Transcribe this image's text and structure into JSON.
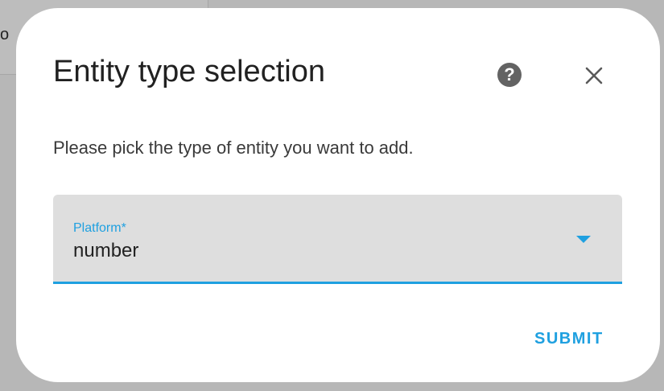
{
  "background": {
    "partial_text": "o"
  },
  "dialog": {
    "title": "Entity type selection",
    "help_icon": "help-circle-icon",
    "help_glyph": "?",
    "close_icon": "close-icon",
    "description": "Please pick the type of entity you want to add.",
    "platform_field": {
      "label": "Platform*",
      "value": "number"
    },
    "submit_label": "SUBMIT"
  },
  "colors": {
    "accent": "#1fa0e0",
    "dialog_background": "#ffffff",
    "field_background": "#dedede",
    "overlay": "#9e9e9e"
  }
}
